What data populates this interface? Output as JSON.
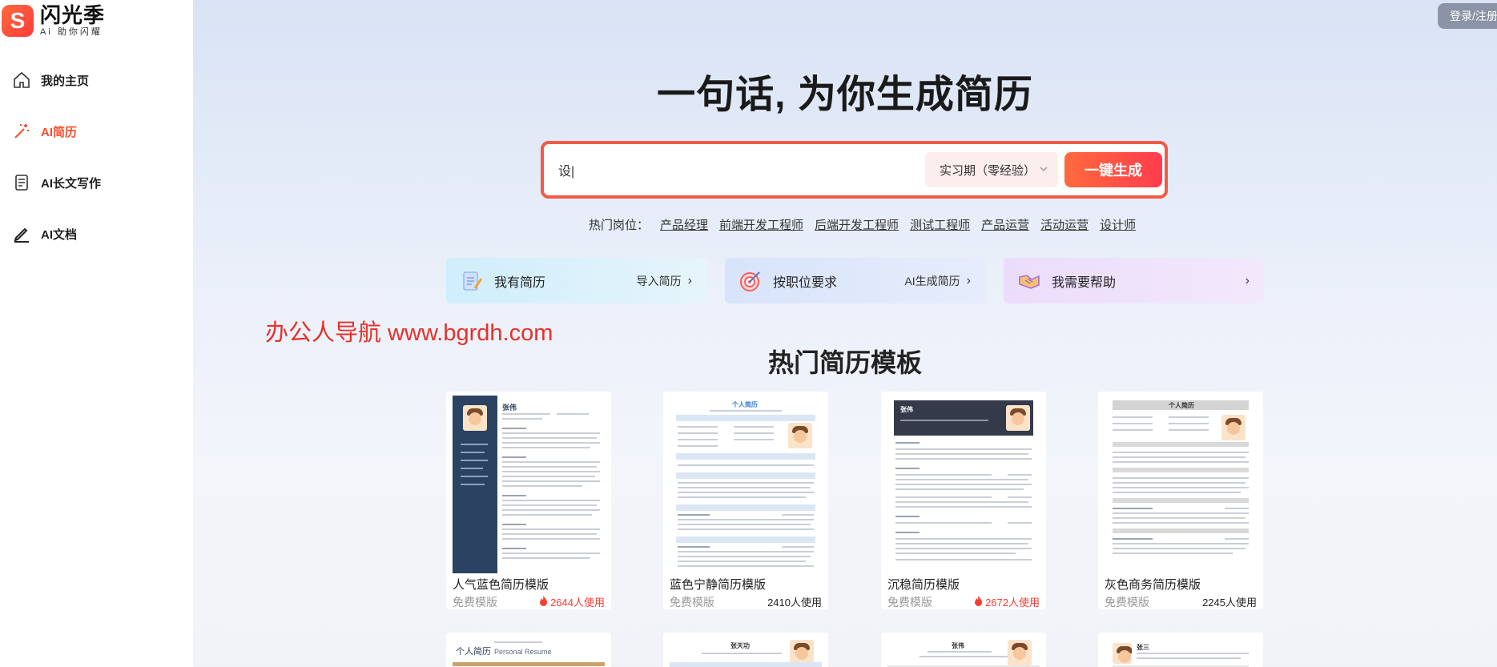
{
  "brand": {
    "name": "闪光季",
    "slogan": "Ai 助你闪耀",
    "logo_letter": "S"
  },
  "nav": [
    {
      "label": "我的主页",
      "icon": "home-icon",
      "active": false
    },
    {
      "label": "AI简历",
      "icon": "magic-wand-icon",
      "active": true
    },
    {
      "label": "AI长文写作",
      "icon": "document-list-icon",
      "active": false
    },
    {
      "label": "AI文档",
      "icon": "pen-icon",
      "active": false
    }
  ],
  "header": {
    "login_label": "登录/注册"
  },
  "hero": {
    "title": "一句话, 为你生成简历",
    "search_value": "设|",
    "stage_value": "实习期（零经验）",
    "generate_label": "一键生成"
  },
  "hot_jobs": {
    "label": "热门岗位：",
    "items": [
      "产品经理",
      "前端开发工程师",
      "后端开发工程师",
      "测试工程师",
      "产品运营",
      "活动运营",
      "设计师"
    ]
  },
  "actions": [
    {
      "title": "我有简历",
      "sub": "导入简历",
      "arrow": "›"
    },
    {
      "title": "按职位要求",
      "sub": "AI生成简历",
      "arrow": "›"
    },
    {
      "title": "我需要帮助",
      "sub": "",
      "arrow": "›"
    }
  ],
  "watermark": "办公人导航 www.bgrdh.com",
  "templates": {
    "title": "热门简历模板",
    "items": [
      {
        "name": "人气蓝色简历模版",
        "free": "免费模版",
        "uses": "2644人使用",
        "hot": true,
        "thumb_name": "张伟"
      },
      {
        "name": "蓝色宁静简历模版",
        "free": "免费模版",
        "uses": "2410人使用",
        "hot": false,
        "thumb_name": "个人简历"
      },
      {
        "name": "沉稳简历模版",
        "free": "免费模版",
        "uses": "2672人使用",
        "hot": true,
        "thumb_name": "张伟"
      },
      {
        "name": "灰色商务简历模版",
        "free": "免费模版",
        "uses": "2245人使用",
        "hot": false,
        "thumb_name": "个人简历"
      }
    ],
    "row2": [
      {
        "thumb_title": "个人简历",
        "thumb_sub": "Personal Resume"
      },
      {
        "thumb_title": "张天功"
      },
      {
        "thumb_title": "张伟"
      },
      {
        "thumb_title": "张三"
      }
    ]
  },
  "colors": {
    "accent": "#ff4b2b",
    "navy": "#2b4262",
    "watermark": "#e6312a"
  }
}
